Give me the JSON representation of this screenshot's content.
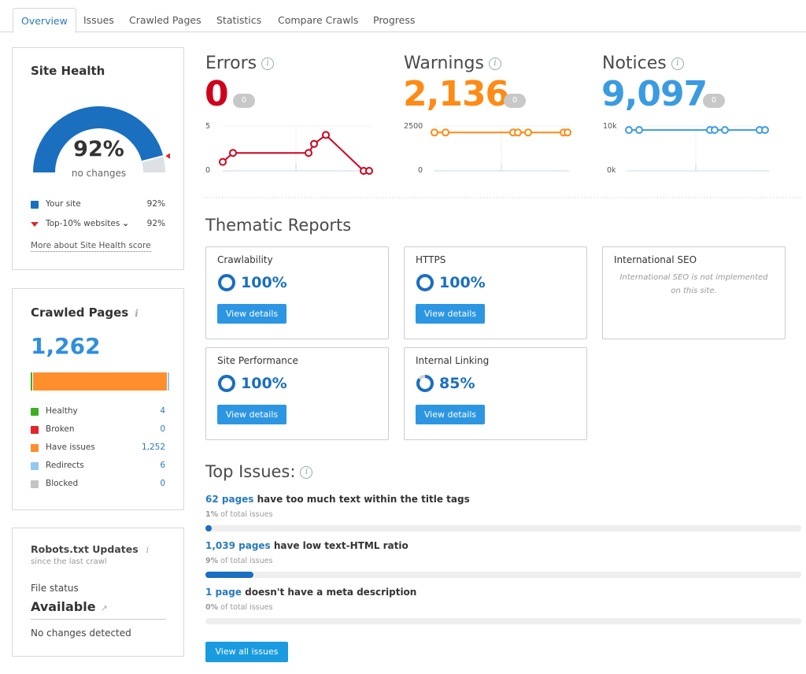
{
  "tabs": [
    {
      "label": "Overview",
      "active": true
    },
    {
      "label": "Issues"
    },
    {
      "label": "Crawled Pages"
    },
    {
      "label": "Statistics"
    },
    {
      "label": "Compare Crawls"
    },
    {
      "label": "Progress"
    }
  ],
  "site_health": {
    "title": "Site Health",
    "percent": "92%",
    "value": 92,
    "top10_value": 92,
    "change_text": "no changes",
    "legend": [
      {
        "label": "Your site",
        "value": "92%",
        "color": "#1a6fbf"
      },
      {
        "label": "Top-10% websites",
        "value": "92%",
        "color": "#e1262d"
      }
    ],
    "more_link": "More about Site Health score"
  },
  "crawled_pages": {
    "title": "Crawled Pages",
    "total": "1,262",
    "segments": [
      {
        "label": "Healthy",
        "value": "4",
        "count": 4,
        "color": "#3dae24"
      },
      {
        "label": "Broken",
        "value": "0",
        "count": 0,
        "color": "#e3242b"
      },
      {
        "label": "Have issues",
        "value": "1,252",
        "count": 1252,
        "color": "#ff8f2c"
      },
      {
        "label": "Redirects",
        "value": "6",
        "count": 6,
        "color": "#93c8ef"
      },
      {
        "label": "Blocked",
        "value": "0",
        "count": 0,
        "color": "#c4c4c4"
      }
    ]
  },
  "robots": {
    "title": "Robots.txt Updates",
    "subtitle": "since the last crawl",
    "file_status_label": "File status",
    "file_status": "Available",
    "changes": "No changes detected"
  },
  "metrics": [
    {
      "key": "errors",
      "title": "Errors",
      "value": "0",
      "delta": "0",
      "color": "#d0021b",
      "y_max_label": "5",
      "y_min_label": "0",
      "y_max": 5,
      "y_min": 0,
      "points": [
        1,
        2,
        2,
        3,
        4,
        0,
        0
      ]
    },
    {
      "key": "warnings",
      "title": "Warnings",
      "value": "2,136",
      "delta": "0",
      "color": "#ff8a14",
      "y_max_label": "2500",
      "y_min_label": "0",
      "y_max": 2500,
      "y_min": 0,
      "points": [
        2136,
        2136,
        2136,
        2136,
        2136,
        2136,
        2136
      ]
    },
    {
      "key": "notices",
      "title": "Notices",
      "value": "9,097",
      "delta": "0",
      "color": "#3b9be0",
      "y_max_label": "10k",
      "y_min_label": "0k",
      "y_max": 10000,
      "y_min": 0,
      "points": [
        9097,
        9097,
        9097,
        9097,
        9097,
        9097,
        9097
      ]
    }
  ],
  "chart_data": [
    {
      "type": "line",
      "title": "Errors",
      "x_index": [
        1,
        2,
        3,
        4,
        5,
        6,
        7
      ],
      "values": [
        1,
        2,
        2,
        3,
        4,
        0,
        0
      ],
      "ylim": [
        0,
        5
      ]
    },
    {
      "type": "line",
      "title": "Warnings",
      "x_index": [
        1,
        2,
        3,
        4,
        5,
        6,
        7
      ],
      "values": [
        2136,
        2136,
        2136,
        2136,
        2136,
        2136,
        2136
      ],
      "ylim": [
        0,
        2500
      ]
    },
    {
      "type": "line",
      "title": "Notices",
      "x_index": [
        1,
        2,
        3,
        4,
        5,
        6,
        7
      ],
      "values": [
        9097,
        9097,
        9097,
        9097,
        9097,
        9097,
        9097
      ],
      "ylim": [
        0,
        10000
      ]
    }
  ],
  "thematic": {
    "title": "Thematic Reports",
    "button_label": "View details",
    "reports": [
      {
        "name": "Crawlability",
        "percent": "100%",
        "value": 100
      },
      {
        "name": "HTTPS",
        "percent": "100%",
        "value": 100
      },
      {
        "name": "International SEO",
        "note": "International SEO is not implemented on this site."
      },
      {
        "name": "Site Performance",
        "percent": "100%",
        "value": 100
      },
      {
        "name": "Internal Linking",
        "percent": "85%",
        "value": 85
      }
    ]
  },
  "top_issues": {
    "title": "Top Issues:",
    "items": [
      {
        "count": "62 pages",
        "text": "have too much text within the title tags",
        "pct_label": "1%",
        "pct_suffix": "of total issues",
        "pct": 1
      },
      {
        "count": "1,039 pages",
        "text": "have low text-HTML ratio",
        "pct_label": "9%",
        "pct_suffix": "of total issues",
        "pct": 9
      },
      {
        "count": "1 page",
        "text": "doesn't have a meta description",
        "pct_label": "0%",
        "pct_suffix": "of total issues",
        "pct": 0
      }
    ],
    "view_all_label": "View all issues"
  }
}
